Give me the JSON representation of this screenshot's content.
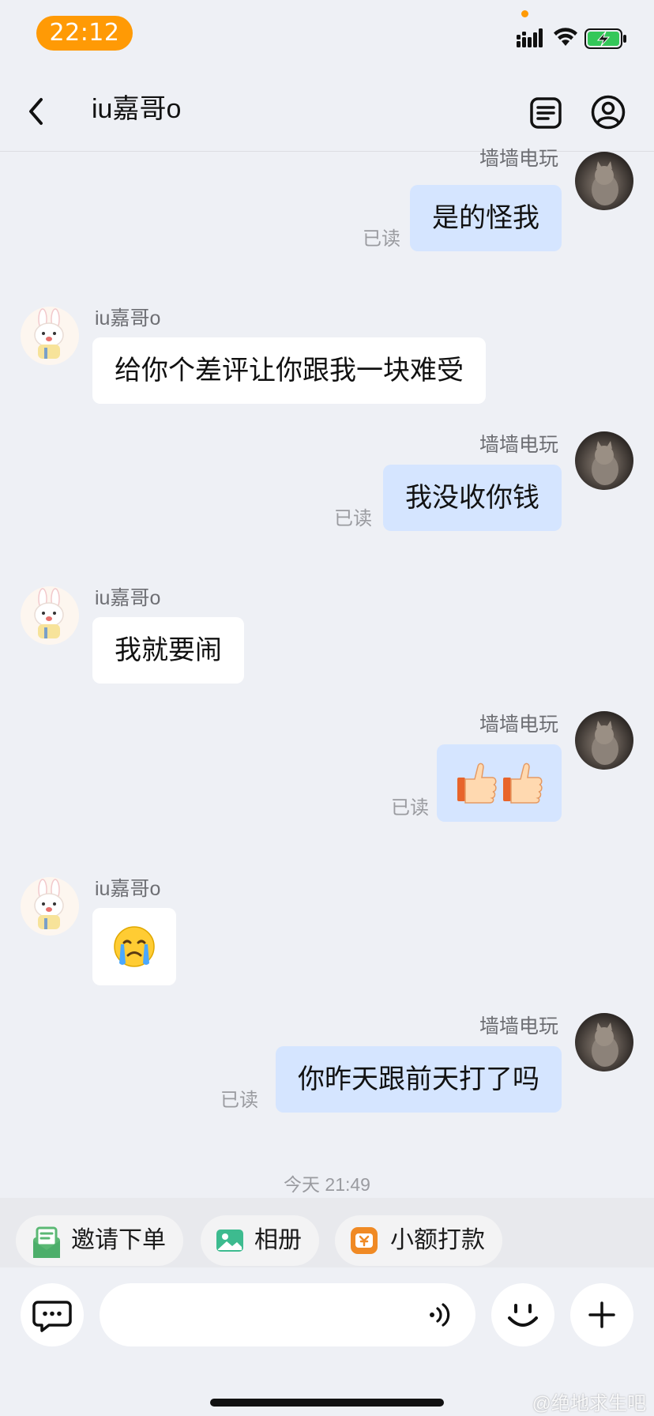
{
  "status_bar": {
    "time": "22:12",
    "accent_color": "#ff9a05"
  },
  "nav": {
    "title": "iu嘉哥o",
    "back_icon": "chevron-left-icon",
    "orders_icon": "document-list-icon",
    "profile_icon": "user-circle-icon"
  },
  "messages": [
    {
      "direction": "out",
      "sender": "墙墙电玩",
      "text": "是的怪我",
      "read": "已读"
    },
    {
      "direction": "in",
      "sender": "iu嘉哥o",
      "text": "给你个差评让你跟我一块难受"
    },
    {
      "direction": "out",
      "sender": "墙墙电玩",
      "text": "我没收你钱",
      "read": "已读"
    },
    {
      "direction": "in",
      "sender": "iu嘉哥o",
      "text": "我就要闹"
    },
    {
      "direction": "out",
      "sender": "墙墙电玩",
      "emoji": "thumbs-up-thumbs-up",
      "read": "已读"
    },
    {
      "direction": "in",
      "sender": "iu嘉哥o",
      "emoji": "crying-face"
    },
    {
      "direction": "out",
      "sender": "墙墙电玩",
      "text": "你昨天跟前天打了吗",
      "read": "已读"
    }
  ],
  "timestamp": "今天 21:49",
  "quick_actions": [
    {
      "label": "邀请下单",
      "icon": "order-invite-icon",
      "color": "#4cae6a"
    },
    {
      "label": "相册",
      "icon": "photo-album-icon",
      "color": "#3dbb8f"
    },
    {
      "label": "小额打款",
      "icon": "small-payment-icon",
      "color": "#f08a24"
    }
  ],
  "input": {
    "placeholder": "",
    "value": ""
  },
  "watermark": "@绝地求生吧",
  "colors": {
    "outgoing_bubble": "#d5e5ff",
    "incoming_bubble": "#ffffff",
    "background": "#eef0f5"
  }
}
